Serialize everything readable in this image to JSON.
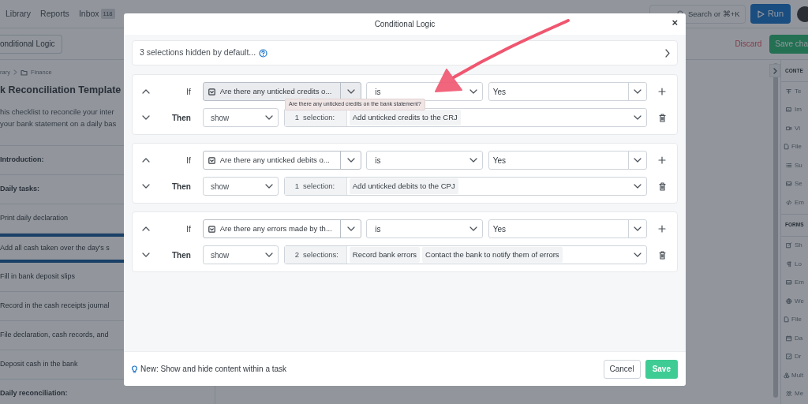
{
  "top_nav": {
    "links": [
      {
        "label": "Library"
      },
      {
        "label": "Reports"
      },
      {
        "label": "Inbox",
        "badge": "118"
      }
    ],
    "search": {
      "placeholder": "Search or ⌘+K"
    },
    "run_button": "Run"
  },
  "toolbar": {
    "button": "onditional Logic",
    "discard": "Discard",
    "save": "Save cha"
  },
  "checklist": {
    "breadcrumb": [
      "rary",
      "Finance"
    ],
    "title": "k Reconciliation Template",
    "description": [
      "his checklist to reconcile your inter",
      "your bank statement on a daily bas"
    ],
    "items": [
      {
        "label": "Introduction:",
        "kind": "heading",
        "selected": false
      },
      {
        "label": "Daily tasks:",
        "kind": "heading",
        "selected": false
      },
      {
        "label": "Print daily declaration",
        "kind": "task",
        "selected": false
      },
      {
        "label": "Add all cash taken over the day's s",
        "kind": "task",
        "selected": true
      },
      {
        "label": "Fill in bank deposit slips",
        "kind": "task",
        "selected": false
      },
      {
        "label": "Record in the cash receipts journal",
        "kind": "task",
        "selected": false
      },
      {
        "label": "File declaration, cash records, and",
        "kind": "task",
        "selected": false
      },
      {
        "label": "Deposit cash in the bank",
        "kind": "task",
        "selected": false
      },
      {
        "label": "Daily reconciliation:",
        "kind": "heading",
        "selected": false
      }
    ]
  },
  "content_sidebar": {
    "sections": [
      {
        "title": "CONTE",
        "items": [
          "Te",
          "Im",
          "Vi",
          "File",
          "Su",
          "Se",
          "Em"
        ]
      },
      {
        "title": "FORMS",
        "items": [
          "Sh",
          "Lo",
          "Em",
          "We",
          "File",
          "Da",
          "Dr",
          "Mult",
          "Me"
        ]
      }
    ]
  },
  "modal": {
    "title": "Conditional Logic",
    "close": "×",
    "hidden_bar": "3 selections hidden by default...",
    "rules": [
      {
        "if_label": "If",
        "question": "Are there any unticked credits o...",
        "highlighted": true,
        "tooltip": "Are there any unticked credits on the bank statement?",
        "operator": "is",
        "value": "Yes",
        "then_label": "Then",
        "action": "show",
        "selection_count": "1",
        "selection_label": "selection:",
        "selections": [
          "Add unticked credits to the CRJ"
        ]
      },
      {
        "if_label": "If",
        "question": "Are there any unticked debits o...",
        "highlighted": false,
        "operator": "is",
        "value": "Yes",
        "then_label": "Then",
        "action": "show",
        "selection_count": "1",
        "selection_label": "selection:",
        "selections": [
          "Add unticked debits to the CPJ"
        ]
      },
      {
        "if_label": "If",
        "question": "Are there any errors made by th...",
        "highlighted": false,
        "operator": "is",
        "value": "Yes",
        "then_label": "Then",
        "action": "show",
        "selection_count": "2",
        "selection_label": "selections:",
        "selections": [
          "Record bank errors",
          "Contact the bank to notify them of errors"
        ]
      }
    ],
    "tip": "New: Show and hide content within a task",
    "cancel": "Cancel",
    "save": "Save"
  }
}
